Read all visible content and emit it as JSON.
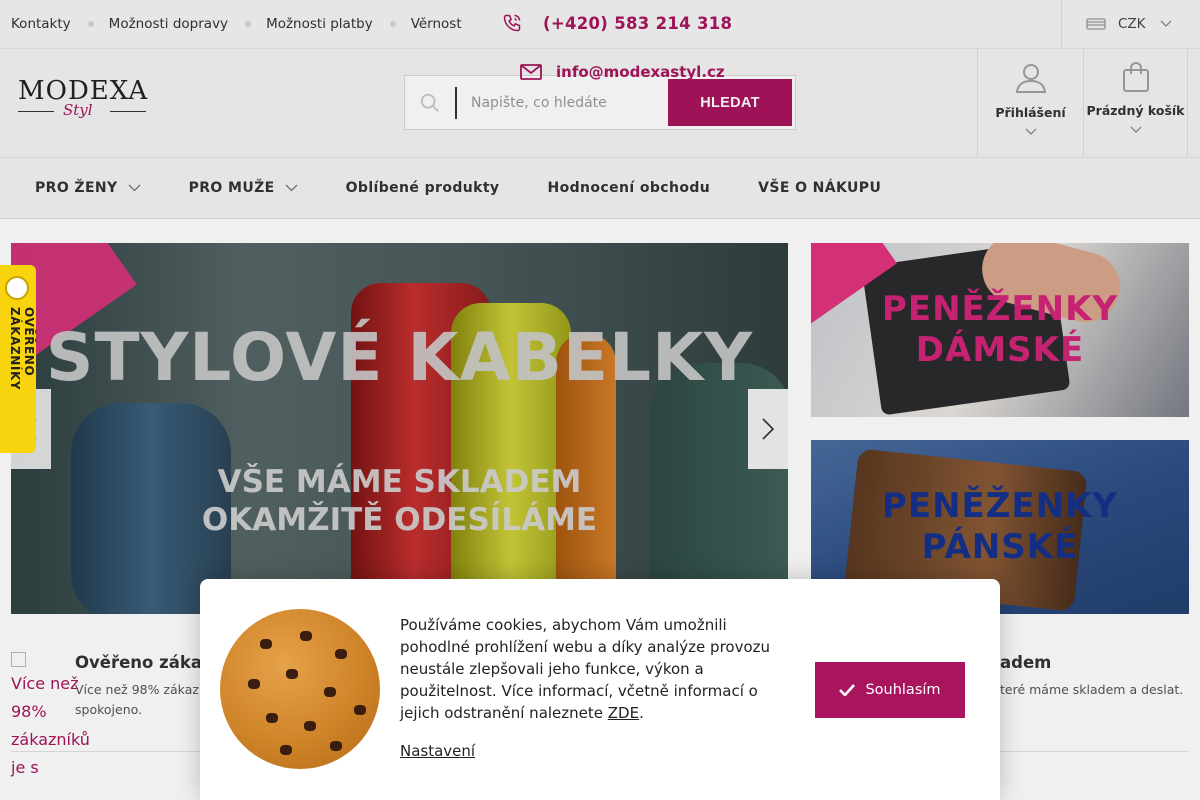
{
  "topbar": {
    "links": [
      "Kontakty",
      "Možnosti dopravy",
      "Možnosti platby",
      "Věrnost"
    ],
    "phone": "(+420) 583 214 318",
    "email": "info@modexastyl.cz",
    "currency": "CZK"
  },
  "header": {
    "logo_main": "MODEXA",
    "logo_sub": "Styl",
    "search_placeholder": "Napište, co hledáte",
    "search_button": "HLEDAT",
    "login_label": "Přihlášení",
    "cart_label": "Prázdný košík"
  },
  "nav": {
    "items": [
      "PRO ŽENY",
      "PRO MUŽE",
      "Oblíbené produkty",
      "Hodnocení obchodu",
      "VŠE O NÁKUPU"
    ]
  },
  "banner": {
    "headline": "STYLOVÉ KABELKY",
    "line1": "VŠE MÁME SKLADEM",
    "line2": "OKAMŽITĚ ODESÍLÁME"
  },
  "side_banners": [
    {
      "line1": "PENĚŽENKY",
      "line2": "DÁMSKÉ"
    },
    {
      "line1": "PENĚŽENKY",
      "line2": "PÁNSKÉ"
    }
  ],
  "verified_tab": "OVĚŘENO ZÁKAZNÍKY",
  "features": {
    "side_text": "Více než 98% zákazníků je s",
    "f1_title": "Ověřeno zákaz",
    "f1_desc": "Více než 98% zákazn spokojeno.",
    "f2_title": "adem",
    "f2_desc": "teré máme skladem a deslat."
  },
  "cookie": {
    "text": "Používáme cookies, abychom Vám umožnili pohodlné prohlížení webu a díky analýze provozu neustále zlepšovali jeho funkce, výkon a použitelnost. Více informací, včetně informací o jejich odstranění naleznete",
    "link": "ZDE",
    "period": ".",
    "settings": "Nastavení",
    "accept": "Souhlasím"
  },
  "colors": {
    "accent": "#a8155e",
    "verified": "#f7d40d"
  }
}
